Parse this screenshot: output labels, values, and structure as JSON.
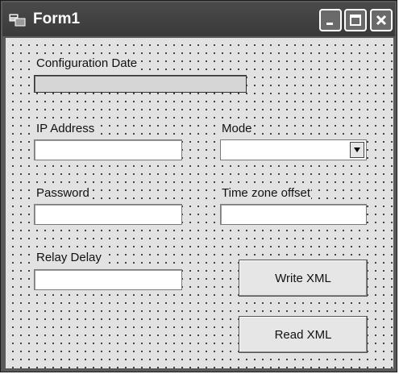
{
  "window": {
    "title": "Form1",
    "minimize_icon": "minimize-icon",
    "maximize_icon": "maximize-icon",
    "close_icon": "close-icon"
  },
  "form": {
    "config_date_label": "Configuration  Date",
    "config_date_value": "",
    "ip_label": "IP Address",
    "ip_value": "",
    "mode_label": "Mode",
    "mode_value": "",
    "password_label": "Password",
    "password_value": "",
    "tz_label": "Time zone offset",
    "tz_value": "",
    "relay_label": "Relay Delay",
    "relay_value": "",
    "write_button": "Write XML",
    "read_button": "Read XML"
  }
}
